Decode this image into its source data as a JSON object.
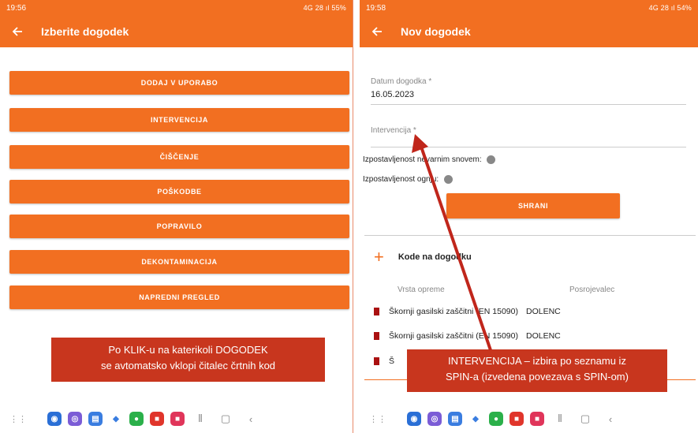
{
  "left": {
    "status": {
      "time": "19:56",
      "right": "4G  28 ıl 55%"
    },
    "appbar": {
      "title": "Izberite dogodek"
    },
    "menu": [
      "DODAJ V UPORABO",
      "INTERVENCIJA",
      "ČIŠČENJE",
      "POŠKODBE",
      "POPRAVILO",
      "DEKONTAMINACIJA",
      "NAPREDNI PREGLED"
    ],
    "callout": [
      "Po KLIK-u na katerikoli DOGODEK",
      "se avtomatsko vklopi čitalec črtnih kod"
    ]
  },
  "right": {
    "status": {
      "time": "19:58",
      "right": "4G  28 ıl 54%"
    },
    "appbar": {
      "title": "Nov dogodek"
    },
    "date_label": "Datum dogodka *",
    "date_value": "16.05.2023",
    "intervention_placeholder": "Intervencija *",
    "hazard_label": "Izpostavljenost nevarnim snovem:",
    "fire_label": "Izpostavljenost ognju:",
    "save": "SHRANI",
    "codes_title": "Kode na dogodku",
    "col_type": "Vrsta opreme",
    "col_owner": "Posrojevalec",
    "rows": [
      {
        "item": "Škornji gasilski zaščitni (EN 15090)",
        "owner": "DOLENC"
      },
      {
        "item": "Škornji gasilski zaščitni (EN 15090)",
        "owner": "DOLENC"
      },
      {
        "item": "Š",
        "owner": ""
      }
    ],
    "callout": [
      "INTERVENCIJA – izbira po seznamu iz",
      "SPIN-a (izvedena povezava s SPIN-om)"
    ]
  },
  "colors": {
    "accent": "#f26f21",
    "callout": "#c8361e",
    "arrow": "#c0261b"
  },
  "nav_icons": [
    "grid-icon",
    "samsung-icon",
    "viber-icon",
    "messages-icon",
    "bell-icon",
    "whatsapp-icon",
    "pdf-icon",
    "screen-recorder-icon",
    "recents-icon",
    "home-icon",
    "back-icon"
  ]
}
